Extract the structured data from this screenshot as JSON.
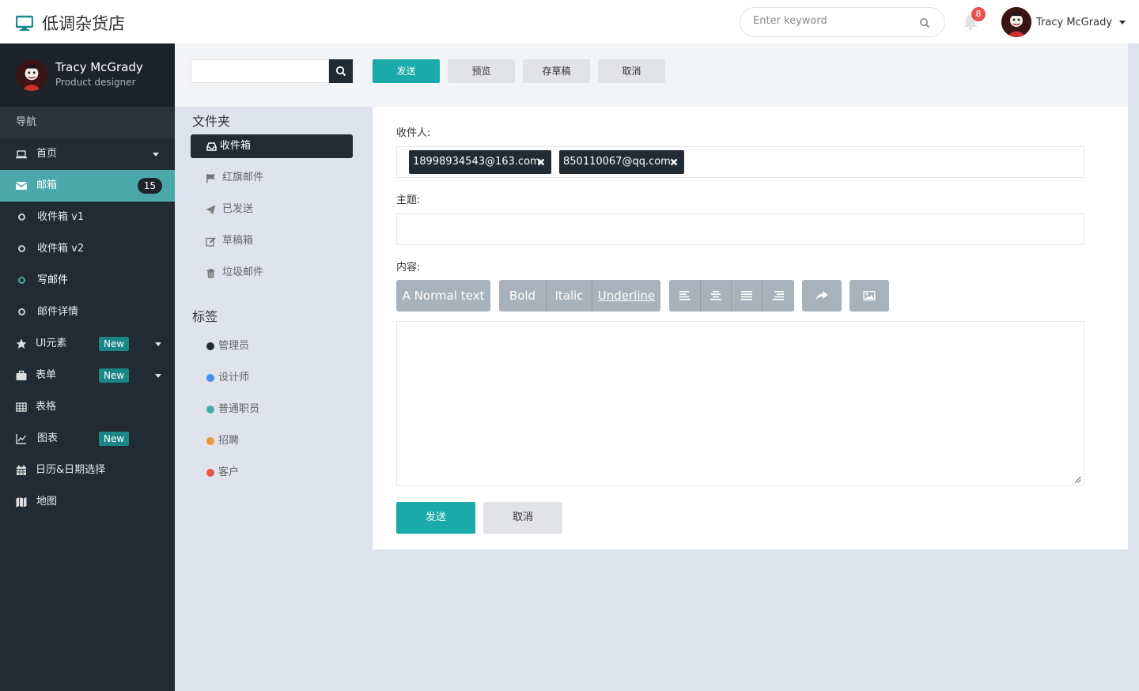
{
  "header": {
    "brand_title": "低调杂货店",
    "search_placeholder": "Enter keyword",
    "notification_count": "8",
    "user_name": "Tracy McGrady"
  },
  "sidebar": {
    "profile": {
      "name": "Tracy McGrady",
      "role": "Product designer"
    },
    "nav_header": "导航",
    "items": [
      {
        "label": "首页",
        "icon": "laptop-icon"
      },
      {
        "label": "邮箱",
        "icon": "envelope-icon",
        "badge": "15"
      },
      {
        "label": "UI元素",
        "icon": "star-icon",
        "badge": "New"
      },
      {
        "label": "表单",
        "icon": "briefcase-icon",
        "badge": "New"
      },
      {
        "label": "表格",
        "icon": "table-icon"
      },
      {
        "label": "图表",
        "icon": "line-chart-icon",
        "badge": "New"
      },
      {
        "label": "日历&日期选择",
        "icon": "calendar-icon"
      },
      {
        "label": "地图",
        "icon": "map-icon"
      }
    ],
    "mail_sub_items": [
      "收件箱 v1",
      "收件箱 v2",
      "写邮件",
      "邮件详情"
    ]
  },
  "toolbar": {
    "send": "发送",
    "preview": "预览",
    "save_draft": "存草稿",
    "cancel": "取消"
  },
  "folders": {
    "title": "文件夹",
    "items": [
      "收件箱",
      "红旗邮件",
      "已发送",
      "草稿箱",
      "垃圾邮件"
    ]
  },
  "tags": {
    "title": "标签",
    "items": [
      {
        "label": "管理员",
        "color": "#222a33"
      },
      {
        "label": "设计师",
        "color": "#4a8df0"
      },
      {
        "label": "普通职员",
        "color": "#4aa9a8"
      },
      {
        "label": "招聘",
        "color": "#f0963a"
      },
      {
        "label": "客户",
        "color": "#e9534f"
      }
    ]
  },
  "compose": {
    "to_label": "收件人:",
    "recipients": [
      "18998934543@163.com",
      "850110067@qq.com"
    ],
    "subject_label": "主题:",
    "subject_value": "",
    "content_label": "内容:",
    "editor_buttons": {
      "normal_text": "A Normal text",
      "bold": "Bold",
      "italic": "Italic",
      "underline": "Underline"
    },
    "send": "发送",
    "cancel": "取消"
  },
  "colors": {
    "accent": "#19aaa9",
    "sidebar_bg": "#222a33",
    "sidebar_active": "#4aa9a8"
  }
}
